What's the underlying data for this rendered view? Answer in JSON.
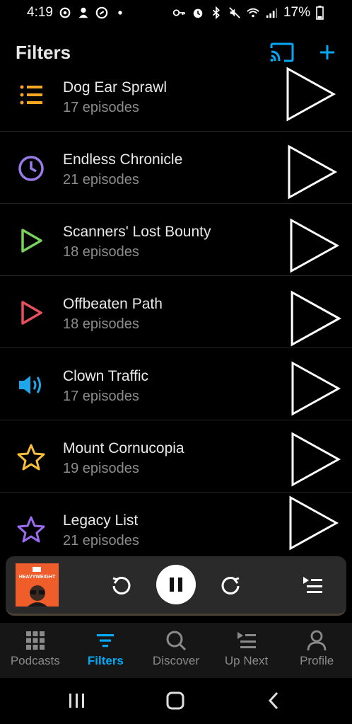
{
  "status_bar": {
    "time": "4:19",
    "battery": "17%"
  },
  "header": {
    "title": "Filters"
  },
  "filters": [
    {
      "name": "Dog Ear Sprawl",
      "count": "17 episodes",
      "icon": "list-icon",
      "color": "#f7a823"
    },
    {
      "name": "Endless Chronicle",
      "count": "21 episodes",
      "icon": "clock-icon",
      "color": "#9b7bea"
    },
    {
      "name": "Scanners' Lost Bounty",
      "count": "18 episodes",
      "icon": "play-outline-icon",
      "color": "#78d25c"
    },
    {
      "name": "Offbeaten Path",
      "count": "18 episodes",
      "icon": "play-outline-icon",
      "color": "#e8505b"
    },
    {
      "name": "Clown Traffic",
      "count": "17 episodes",
      "icon": "speaker-icon",
      "color": "#1ea7e8"
    },
    {
      "name": "Mount Cornucopia",
      "count": "19 episodes",
      "icon": "star-icon",
      "color": "#f7bf3a"
    },
    {
      "name": "Legacy List",
      "count": "21 episodes",
      "icon": "star-icon",
      "color": "#9b6bf0"
    }
  ],
  "mini_player": {
    "artwork_text": "HEAVYWEIGHT",
    "playing": true
  },
  "bottom_nav": [
    {
      "label": "Podcasts",
      "icon": "grid-icon",
      "active": false
    },
    {
      "label": "Filters",
      "icon": "filter-icon",
      "active": true
    },
    {
      "label": "Discover",
      "icon": "search-icon",
      "active": false
    },
    {
      "label": "Up Next",
      "icon": "queue-icon",
      "active": false
    },
    {
      "label": "Profile",
      "icon": "person-icon",
      "active": false
    }
  ],
  "colors": {
    "accent": "#03a9f4",
    "background": "#000000",
    "nav_background": "#161616",
    "player_background": "#2a2a2a"
  }
}
